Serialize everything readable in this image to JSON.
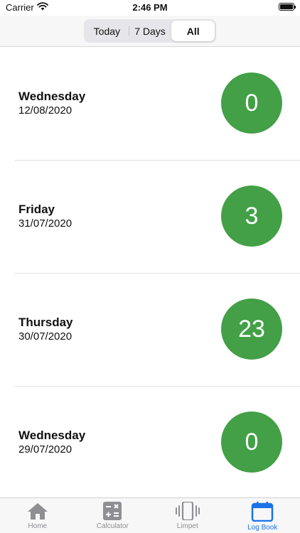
{
  "status": {
    "carrier": "Carrier",
    "time": "2:46 PM"
  },
  "segmented": {
    "options": [
      {
        "label": "Today",
        "selected": false
      },
      {
        "label": "7 Days",
        "selected": false
      },
      {
        "label": "All",
        "selected": true
      }
    ]
  },
  "entries": [
    {
      "day": "Wednesday",
      "date": "12/08/2020",
      "count": "0"
    },
    {
      "day": "Friday",
      "date": "31/07/2020",
      "count": "3"
    },
    {
      "day": "Thursday",
      "date": "30/07/2020",
      "count": "23"
    },
    {
      "day": "Wednesday",
      "date": "29/07/2020",
      "count": "0"
    }
  ],
  "tabs": [
    {
      "label": "Home",
      "icon": "home-icon",
      "active": false
    },
    {
      "label": "Calculator",
      "icon": "calculator-icon",
      "active": false
    },
    {
      "label": "Limpet",
      "icon": "vibrate-icon",
      "active": false
    },
    {
      "label": "Log Book",
      "icon": "calendar-icon",
      "active": true
    }
  ],
  "colors": {
    "accent": "#1a73e8",
    "count_badge": "#43a047",
    "inactive_tab": "#8e8e93"
  }
}
